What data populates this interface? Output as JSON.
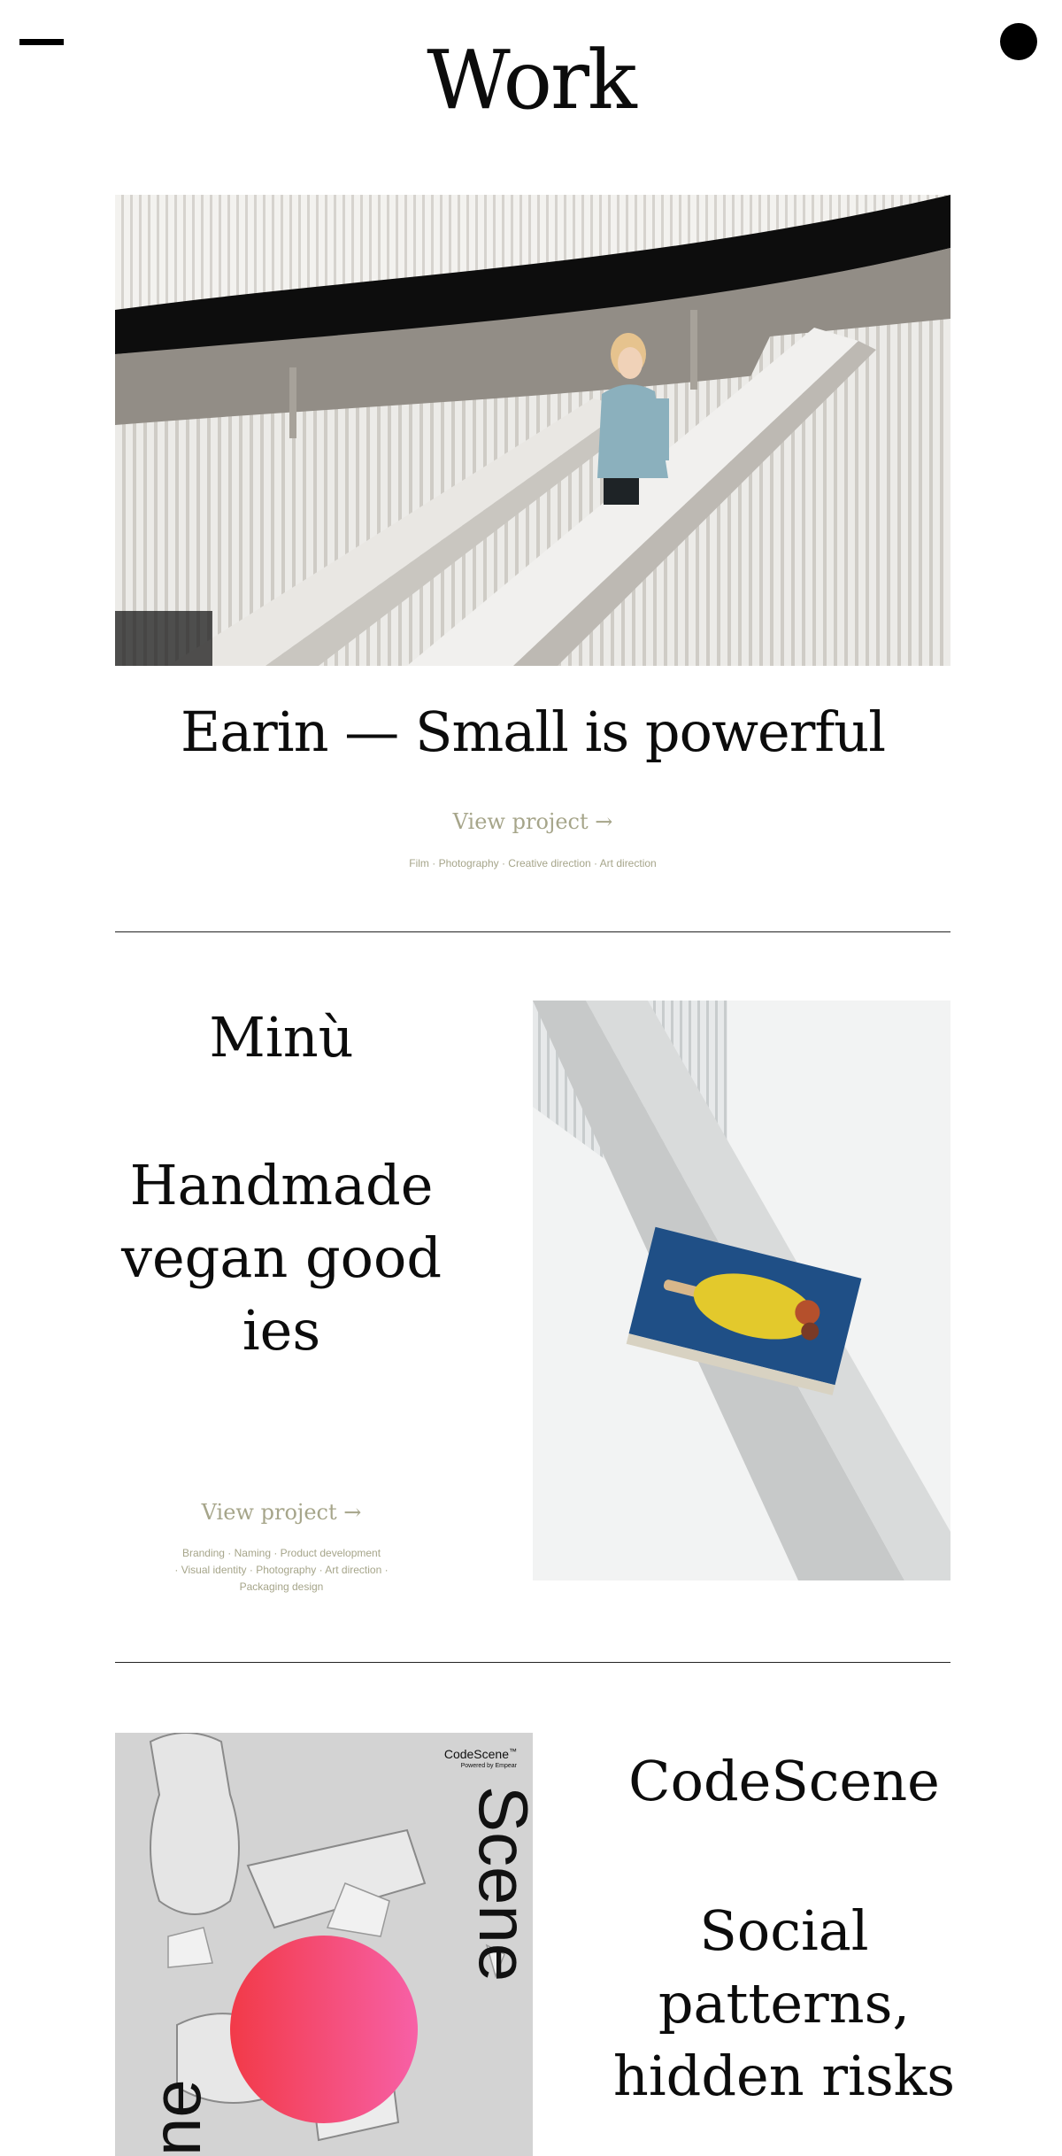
{
  "header": {
    "title": "Work",
    "menu_icon": "menu-icon",
    "dot_icon": "circle-icon"
  },
  "projects": [
    {
      "title": "Earin — Small is powerful",
      "link": "View project →",
      "tags": "Film · Photography · Creative direction · Art direction"
    },
    {
      "title": "Minù",
      "subtitle": "Handmade vegan goodies",
      "link": "View project →",
      "tags_lines": [
        "Branding · Naming · Product development",
        "· Visual identity · Photography · Art direction ·",
        "Packaging design"
      ]
    },
    {
      "title": "CodeScene",
      "subtitle_lines": [
        "Social",
        "patterns,",
        "hidden risks"
      ],
      "poster": {
        "brand": "CodeScene",
        "brand_sup": "™",
        "powered": "Powered by Empear",
        "vertical_text": "Scene",
        "vertical_text_bottom": "ne"
      }
    }
  ],
  "colors": {
    "accent_link": "#a6a58a",
    "blob_start": "#f23a48",
    "blob_end": "#f760a6"
  }
}
